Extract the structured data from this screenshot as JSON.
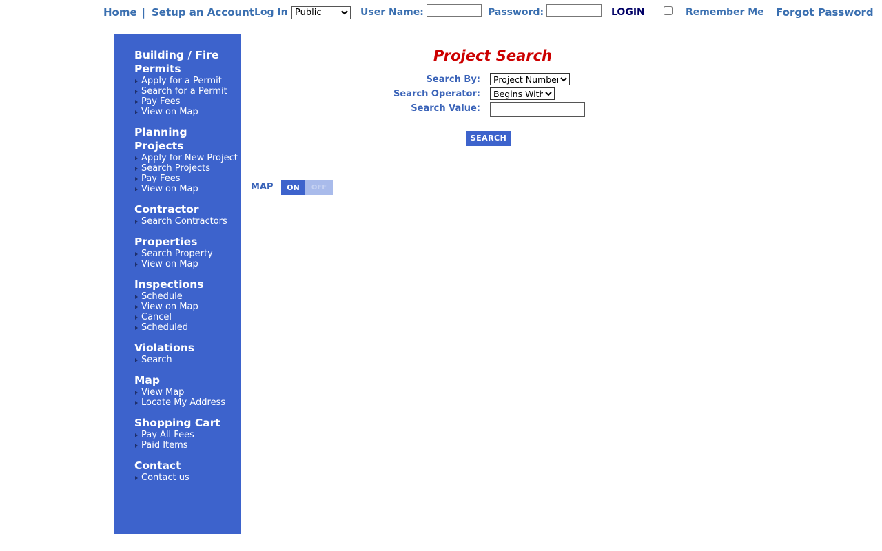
{
  "topbar": {
    "home": "Home",
    "separator": "|",
    "setup_account": "Setup an Account",
    "log_in_label": "Log In",
    "role_options": [
      "Public"
    ],
    "role_selected": "Public",
    "username_label": "User Name:",
    "password_label": "Password:",
    "login_button": "LOGIN",
    "remember_me": "Remember Me",
    "forgot_password": "Forgot Password"
  },
  "sidebar": {
    "sections": [
      {
        "title": "Building / Fire Permits",
        "items": [
          "Apply for a Permit",
          "Search for a Permit",
          "Pay Fees",
          "View on Map"
        ]
      },
      {
        "title": "Planning Projects",
        "items": [
          "Apply for New Project",
          "Search Projects",
          "Pay Fees",
          "View on Map"
        ]
      },
      {
        "title": "Contractor",
        "items": [
          "Search Contractors"
        ]
      },
      {
        "title": "Properties",
        "items": [
          "Search Property",
          "View on Map"
        ]
      },
      {
        "title": "Inspections",
        "items": [
          "Schedule",
          "View on Map",
          "Cancel",
          "Scheduled"
        ]
      },
      {
        "title": "Violations",
        "items": [
          "Search"
        ]
      },
      {
        "title": "Map",
        "items": [
          "View Map",
          "Locate My Address"
        ]
      },
      {
        "title": "Shopping Cart",
        "items": [
          "Pay All Fees",
          "Paid Items"
        ]
      },
      {
        "title": "Contact",
        "items": [
          "Contact us"
        ]
      }
    ]
  },
  "search": {
    "title": "Project Search",
    "search_by_label": "Search By:",
    "search_by_options": [
      "Project Number"
    ],
    "search_by_selected": "Project Number",
    "operator_label": "Search Operator:",
    "operator_options": [
      "Begins With"
    ],
    "operator_selected": "Begins With",
    "value_label": "Search Value:",
    "value": "",
    "button": "SEARCH"
  },
  "map_toggle": {
    "label": "MAP",
    "on_label": "ON",
    "off_label": "OFF",
    "state": "ON"
  },
  "colors": {
    "sidebar_bg": "#3d63cc",
    "title_red": "#cc0000",
    "link_blue": "#3a6fb0",
    "login_navy": "#000066"
  }
}
